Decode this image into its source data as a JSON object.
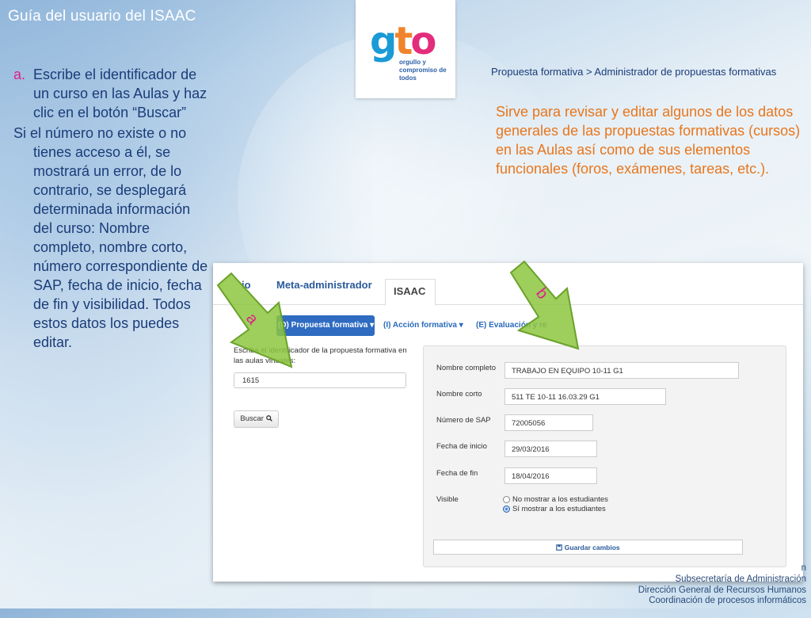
{
  "slide": {
    "title": "Guía del usuario del ISAAC",
    "logo": {
      "mark": "gto",
      "tagline": "orgullo y compromiso de todos"
    },
    "steps": [
      {
        "marker": "a.",
        "text": "Escribe el identificador de un curso en las Aulas y haz clic en el botón “Buscar”"
      }
    ],
    "paragraph": "Si el número no existe o no tienes acceso a él, se mostrará un error, de lo contrario, se desplegará determinada información del curso: Nombre completo, nombre corto, número correspondiente de SAP, fecha de inicio, fecha de fin y visibilidad. Todos estos datos los puedes editar.",
    "breadcrumb": "Propuesta formativa > Administrador de propuestas formativas",
    "description": "Sirve para revisar y editar algunos de los datos generales de las propuestas formativas (cursos) en las Aulas así como de sus elementos funcionales (foros, exámenes, tareas, etc.).",
    "footer": [
      "n",
      "Subsecretaría de Administración",
      "Dirección General de Recursos Humanos",
      "Coordinación de procesos informáticos"
    ],
    "arrow_labels": {
      "a": "a",
      "b": "b"
    }
  },
  "app": {
    "tabs": {
      "partial": "io",
      "meta": "Meta-administrador",
      "active": "ISAAC"
    },
    "menu": {
      "active": "(D) Propuesta formativa ▾",
      "item2": "(I) Acción formativa ▾",
      "item3": "(E) Evaluación y re"
    },
    "search": {
      "prompt": "Escriba el identificador de la propuesta formativa en las aulas virtuales:",
      "value": "1615",
      "button_label": "Buscar",
      "button_icon": "search-icon"
    },
    "form": {
      "fields": [
        {
          "label": "Nombre completo",
          "value": "TRABAJO EN EQUIPO 10-11 G1"
        },
        {
          "label": "Nombre corto",
          "value": "511 TE 10-11 16.03.29 G1"
        },
        {
          "label": "Número de SAP",
          "value": "72005056"
        },
        {
          "label": "Fecha de inicio",
          "value": "29/03/2016"
        },
        {
          "label": "Fecha de fin",
          "value": "18/04/2016"
        }
      ],
      "visible_label": "Visible",
      "visible_options": [
        {
          "label": "No mostrar a los estudiantes",
          "selected": false
        },
        {
          "label": "Sí mostrar a los estudiantes",
          "selected": true
        }
      ],
      "save_label": "Guardar cambios",
      "save_icon": "save-icon"
    }
  },
  "colors": {
    "accent": "#e0208a",
    "orange": "#e8761c",
    "arrow": "#8dc63f",
    "primary": "#2e6bc1"
  }
}
